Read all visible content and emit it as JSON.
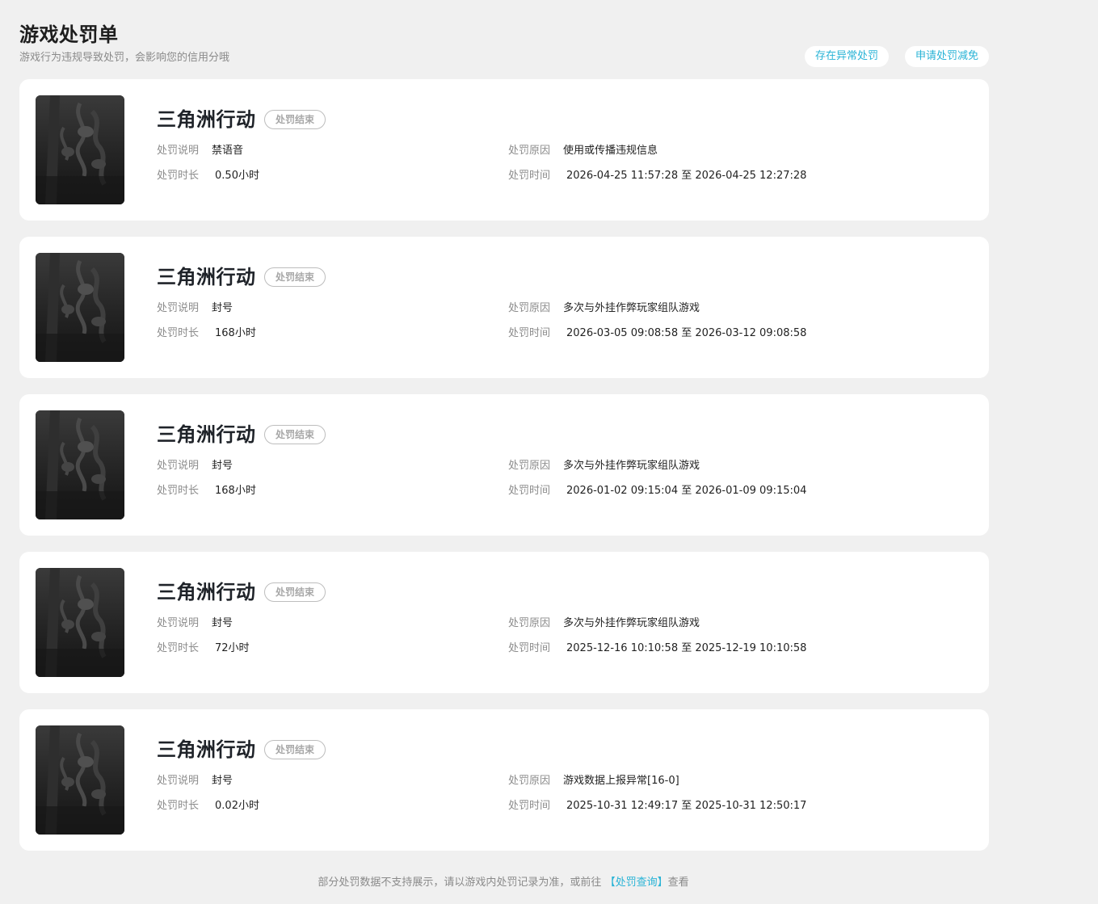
{
  "header": {
    "title": "游戏处罚单",
    "subtitle": "游戏行为违规导致处罚，会影响您的信用分哦",
    "buttons": {
      "abnormal": "存在异常处罚",
      "appeal": "申请处罚减免"
    }
  },
  "labels": {
    "desc": "处罚说明",
    "duration": "处罚时长",
    "reason": "处罚原因",
    "time": "处罚时间"
  },
  "records": [
    {
      "game": "三角洲行动",
      "status": "处罚结束",
      "desc": "禁语音",
      "duration": "0.50小时",
      "reason": "使用或传播违规信息",
      "time": "2026-04-25 11:57:28 至 2026-04-25 12:27:28"
    },
    {
      "game": "三角洲行动",
      "status": "处罚结束",
      "desc": "封号",
      "duration": "168小时",
      "reason": "多次与外挂作弊玩家组队游戏",
      "time": "2026-03-05 09:08:58 至 2026-03-12 09:08:58"
    },
    {
      "game": "三角洲行动",
      "status": "处罚结束",
      "desc": "封号",
      "duration": "168小时",
      "reason": "多次与外挂作弊玩家组队游戏",
      "time": "2026-01-02 09:15:04 至 2026-01-09 09:15:04"
    },
    {
      "game": "三角洲行动",
      "status": "处罚结束",
      "desc": "封号",
      "duration": "72小时",
      "reason": "多次与外挂作弊玩家组队游戏",
      "time": "2025-12-16 10:10:58 至 2025-12-19 10:10:58"
    },
    {
      "game": "三角洲行动",
      "status": "处罚结束",
      "desc": "封号",
      "duration": "0.02小时",
      "reason": "游戏数据上报异常[16-0]",
      "time": "2025-10-31 12:49:17 至 2025-10-31 12:50:17"
    }
  ],
  "footer": {
    "text_before": "部分处罚数据不支持展示，请以游戏内处罚记录为准，或前往",
    "link": "【处罚查询】",
    "text_after": "查看"
  }
}
